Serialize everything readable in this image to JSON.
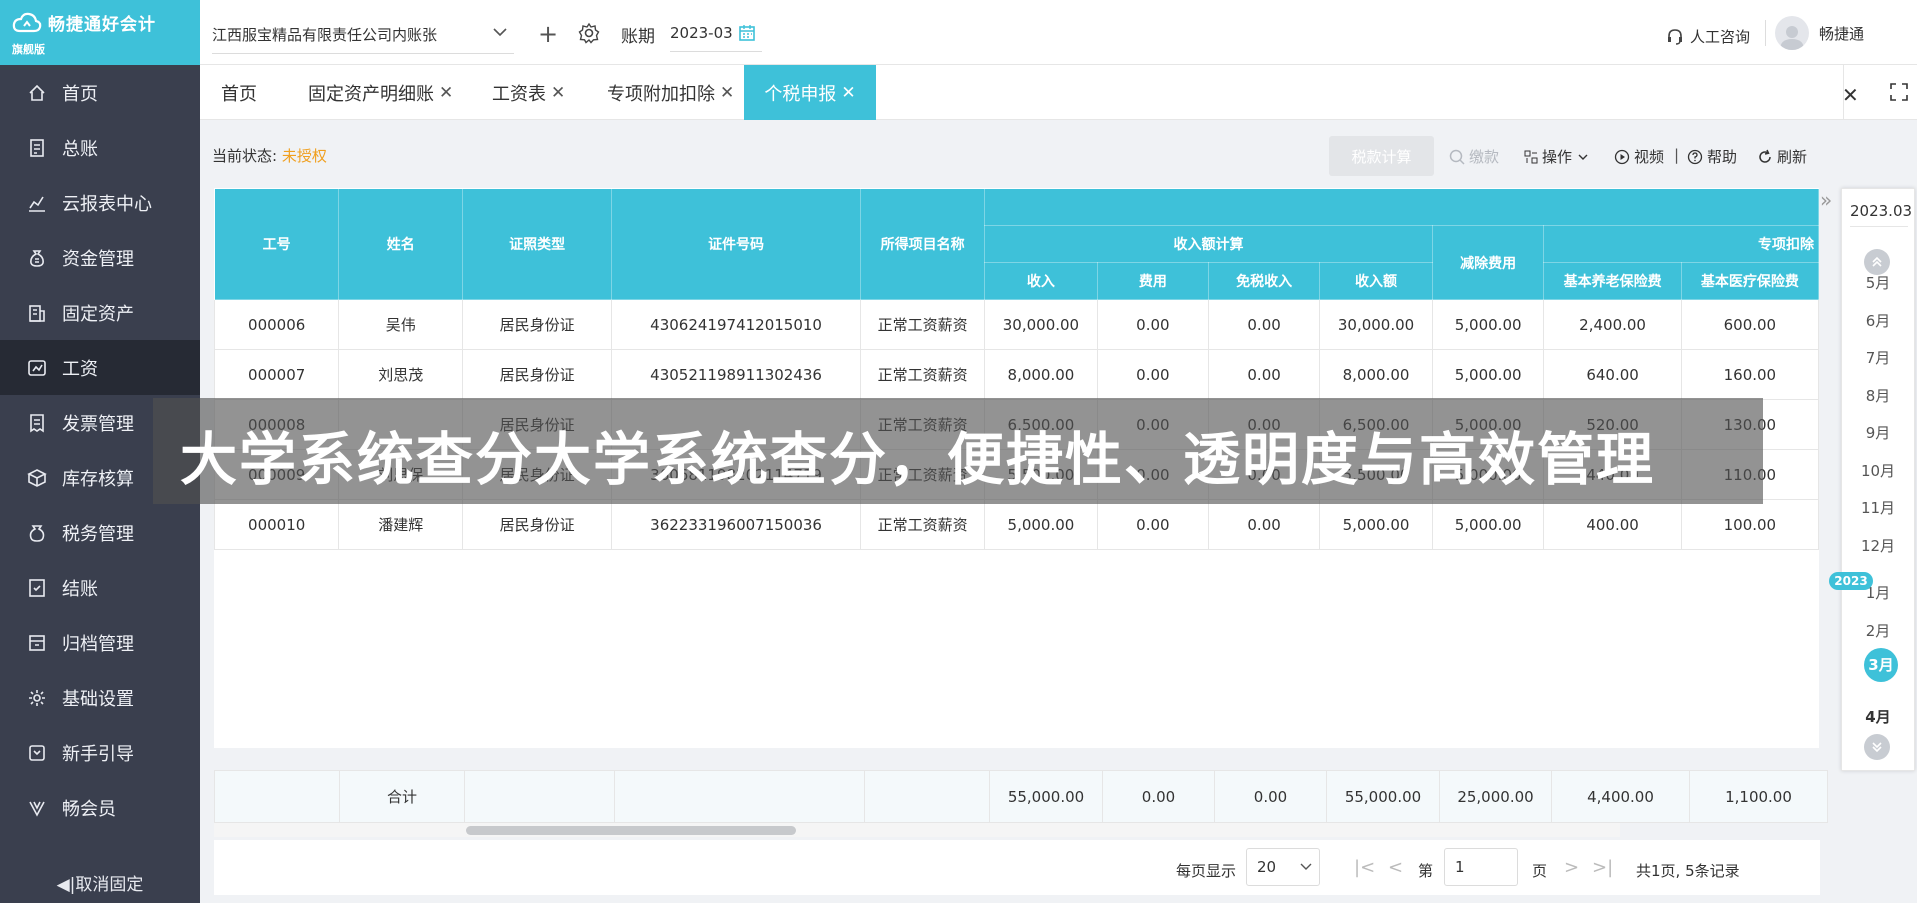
{
  "app": {
    "name": "畅捷通好会计",
    "edition": "旗舰版"
  },
  "sidebar": {
    "items": [
      {
        "label": "首页",
        "icon": "home-icon"
      },
      {
        "label": "总账",
        "icon": "ledger-icon"
      },
      {
        "label": "云报表中心",
        "icon": "chart-icon"
      },
      {
        "label": "资金管理",
        "icon": "money-bag-icon"
      },
      {
        "label": "固定资产",
        "icon": "building-icon"
      },
      {
        "label": "工资",
        "icon": "payroll-icon",
        "active": true
      },
      {
        "label": "发票管理",
        "icon": "invoice-icon"
      },
      {
        "label": "库存核算",
        "icon": "inventory-icon"
      },
      {
        "label": "税务管理",
        "icon": "tax-icon"
      },
      {
        "label": "结账",
        "icon": "checkout-icon"
      },
      {
        "label": "归档管理",
        "icon": "archive-icon"
      },
      {
        "label": "基础设置",
        "icon": "gear-icon"
      },
      {
        "label": "新手引导",
        "icon": "guide-icon"
      },
      {
        "label": "畅会员",
        "icon": "vip-icon"
      }
    ],
    "unpin_label": "◀|取消固定"
  },
  "topbar": {
    "company": "江西服宝精品有限责任公司内账张",
    "period_label": "账期",
    "period_value": "2023-03",
    "consult_label": "人工咨询",
    "user_name": "畅捷通"
  },
  "tabs": [
    {
      "label": "首页",
      "closable": false
    },
    {
      "label": "固定资产明细账",
      "closable": true
    },
    {
      "label": "工资表",
      "closable": true
    },
    {
      "label": "专项附加扣除",
      "closable": true
    },
    {
      "label": "个税申报",
      "closable": true,
      "active": true
    }
  ],
  "page": {
    "status_label": "当前状态:",
    "status_value": "未授权",
    "toolbar": {
      "calc": "税款计算",
      "pay": "缴款",
      "ops": "操作",
      "video": "视频",
      "help": "帮助",
      "refresh": "刷新"
    }
  },
  "table": {
    "headers": {
      "emp_no": "工号",
      "name": "姓名",
      "id_type": "证照类型",
      "id_no": "证件号码",
      "income_item": "所得项目名称",
      "income_calc": "收入额计算",
      "income": "收入",
      "expense": "费用",
      "tax_free": "免税收入",
      "income_amt": "收入额",
      "deduction": "减除费用",
      "special": "专项扣除",
      "pension": "基本养老保险费",
      "medical": "基本医疗保险费"
    },
    "rows": [
      [
        "000006",
        "吴伟",
        "居民身份证",
        "430624197412015010",
        "正常工资薪资",
        "30,000.00",
        "0.00",
        "0.00",
        "30,000.00",
        "5,000.00",
        "2,400.00",
        "600.00"
      ],
      [
        "000007",
        "刘思茂",
        "居民身份证",
        "430521198911302436",
        "正常工资薪资",
        "8,000.00",
        "0.00",
        "0.00",
        "8,000.00",
        "5,000.00",
        "640.00",
        "160.00"
      ],
      [
        "000008",
        "",
        "居民身份证",
        "",
        "正常工资薪资",
        "6,500.00",
        "0.00",
        "0.00",
        "6,500.00",
        "5,000.00",
        "520.00",
        "130.00"
      ],
      [
        "000009",
        "刘思保",
        "居民身份证",
        "360681198202114719",
        "正常工资薪资",
        "5,500.00",
        "0.00",
        "0.00",
        "5,500.00",
        "5,000.00",
        "440.00",
        "110.00"
      ],
      [
        "000010",
        "潘建辉",
        "居民身份证",
        "362233196007150036",
        "正常工资薪资",
        "5,000.00",
        "0.00",
        "0.00",
        "5,000.00",
        "5,000.00",
        "400.00",
        "100.00"
      ]
    ],
    "total": {
      "label": "合计",
      "income": "55,000.00",
      "expense": "0.00",
      "tax_free": "0.00",
      "income_amt": "55,000.00",
      "deduction": "25,000.00",
      "pension": "4,400.00",
      "medical": "1,100.00"
    }
  },
  "pager": {
    "per_page_label": "每页显示",
    "per_page": "20",
    "page_prefix": "第",
    "page": "1",
    "page_suffix": "页",
    "summary": "共1页, 5条记录"
  },
  "month_rail": {
    "current": "2023.03",
    "year_badge": "2023",
    "months": [
      "5月",
      "6月",
      "7月",
      "8月",
      "9月",
      "10月",
      "11月",
      "12月",
      "1月",
      "2月",
      "3月",
      "4月"
    ]
  },
  "banner": {
    "text": "大学系统查分大学系统查分，便捷性、透明度与高效管理"
  },
  "colors": {
    "accent": "#3ec1d9",
    "sidebar": "#3a3f4e",
    "warning": "#f0a020"
  }
}
